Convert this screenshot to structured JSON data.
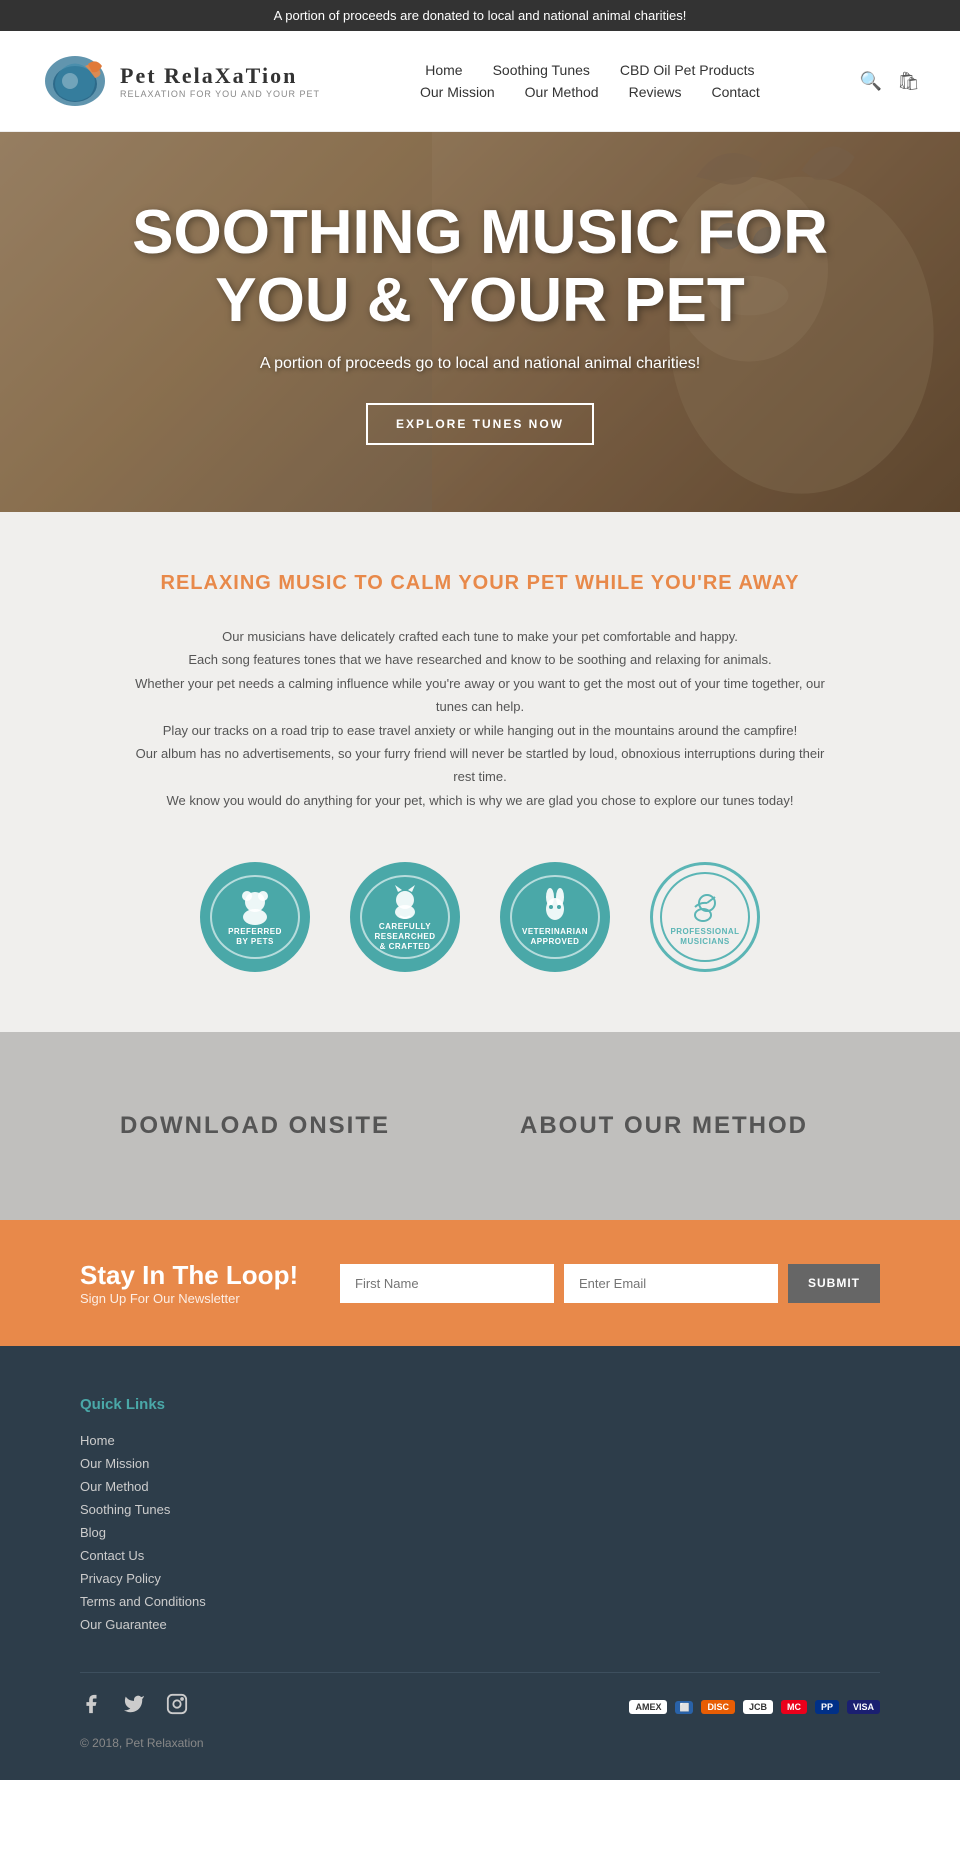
{
  "topBanner": {
    "text": "A portion of proceeds are donated to local and national animal charities!"
  },
  "header": {
    "logoTitle": "Pet RelaXaTion",
    "logoSubtitle": "Relaxation for you and your pet",
    "nav": {
      "row1": [
        {
          "label": "Home",
          "id": "home"
        },
        {
          "label": "Soothing Tunes",
          "id": "soothing-tunes"
        },
        {
          "label": "CBD Oil Pet Products",
          "id": "cbd-oil"
        }
      ],
      "row2": [
        {
          "label": "Our Mission",
          "id": "our-mission"
        },
        {
          "label": "Our Method",
          "id": "our-method"
        },
        {
          "label": "Reviews",
          "id": "reviews"
        },
        {
          "label": "Contact",
          "id": "contact"
        }
      ]
    },
    "searchIcon": "🔍",
    "cartIcon": "🛒"
  },
  "hero": {
    "title": "SOOTHING MUSIC FOR YOU & YOUR PET",
    "subtitle": "A portion of proceeds go to local and national animal charities!",
    "buttonText": "EXPLORE TUNES NOW"
  },
  "features": {
    "title": "RELAXING MUSIC TO CALM YOUR PET WHILE YOU'RE AWAY",
    "paragraphs": [
      "Our musicians have delicately crafted each tune to make your pet comfortable and happy.",
      "Each song features tones that we have researched and know to be soothing and relaxing for animals.",
      "Whether your pet needs a calming influence while you're away or you want to get the most out of your time together, our tunes can help.",
      "Play our tracks on a road trip to ease travel anxiety or while hanging out in the mountains around the campfire!",
      "Our album has no advertisements, so your furry friend will never be startled by loud, obnoxious interruptions during their rest time.",
      "We know you would do anything for your pet, which is why we are glad you chose to explore our tunes today!"
    ],
    "badges": [
      {
        "label": "PREFERRED BY PETS",
        "icon": "🐕"
      },
      {
        "label": "CAREFULLY RESEARCHED & CRAFTED",
        "icon": "🐈"
      },
      {
        "label": "VETERINARIAN APPROVED",
        "icon": "🐇"
      },
      {
        "label": "PROFESSIONAL MUSICIANS",
        "icon": "🐦"
      }
    ]
  },
  "downloadMethod": {
    "downloadTitle": "DOWNLOAD ONSITE",
    "methodTitle": "ABOUT OUR METHOD"
  },
  "newsletter": {
    "heading": "Stay In The Loop!",
    "subtext": "Sign Up For Our Newsletter",
    "firstNamePlaceholder": "First Name",
    "emailPlaceholder": "Enter Email",
    "buttonLabel": "SUBMIT"
  },
  "footer": {
    "quickLinksTitle": "Quick Links",
    "links": [
      {
        "label": "Home"
      },
      {
        "label": "Our Mission"
      },
      {
        "label": "Our Method"
      },
      {
        "label": "Soothing Tunes"
      },
      {
        "label": "Blog"
      },
      {
        "label": "Contact Us"
      },
      {
        "label": "Privacy Policy"
      },
      {
        "label": "Terms and Conditions"
      },
      {
        "label": "Our Guarantee"
      }
    ],
    "payments": [
      "VISA",
      "MC",
      "DISC",
      "AMEX",
      "JCB",
      "PP"
    ],
    "copyright": "© 2018, Pet Relaxation"
  }
}
